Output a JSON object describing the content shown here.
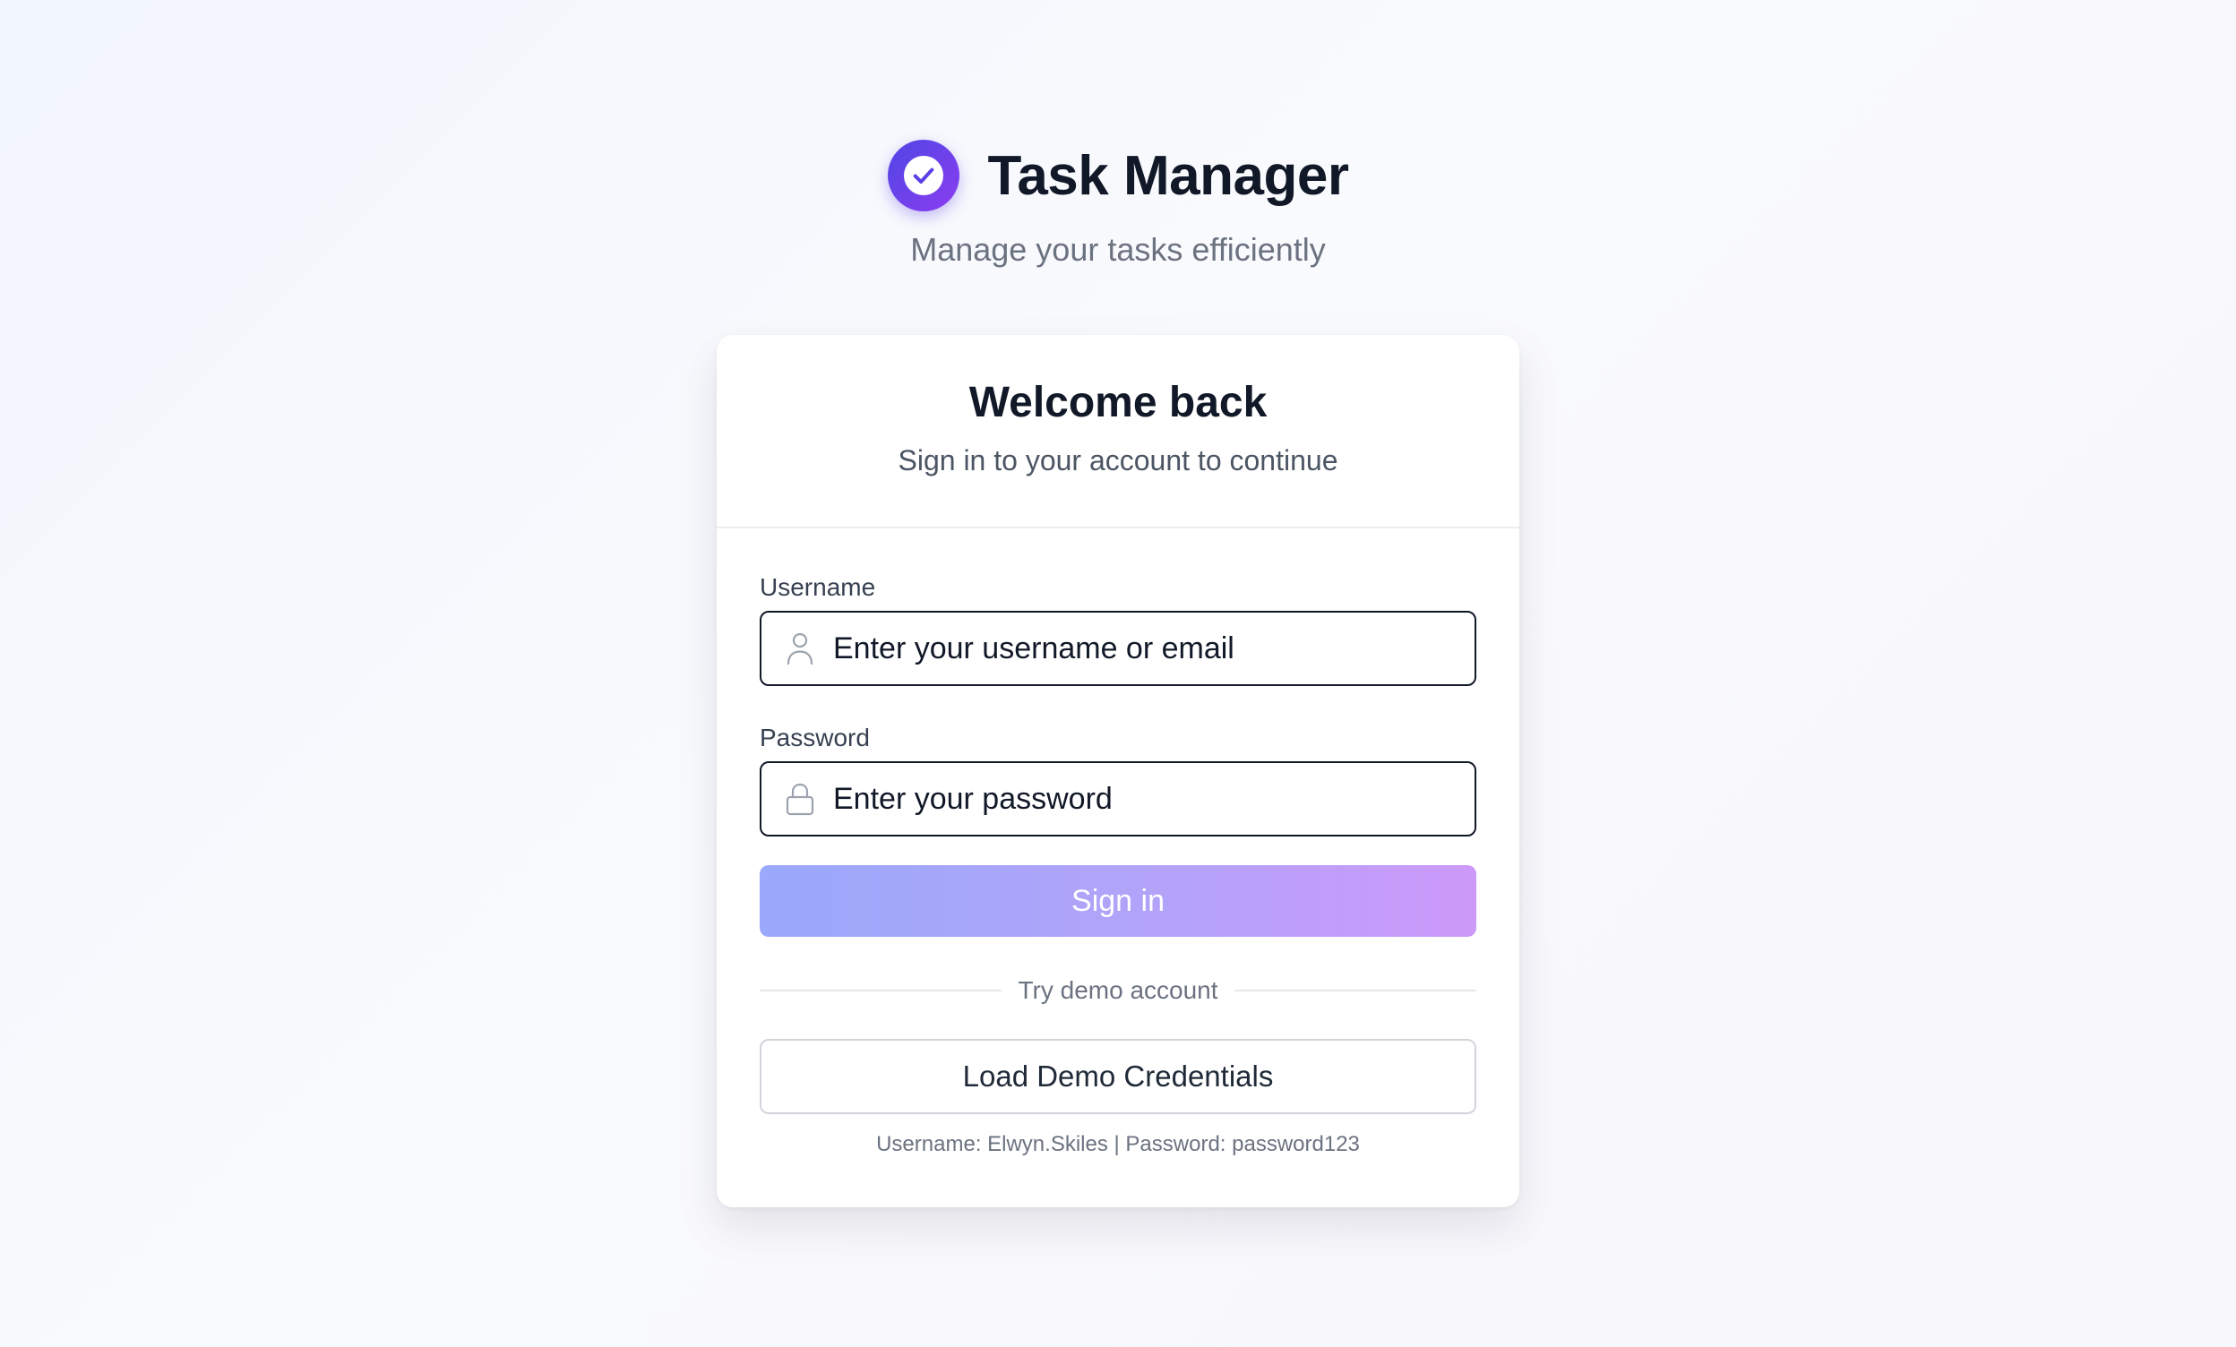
{
  "brand": {
    "title": "Task Manager",
    "subtitle": "Manage your tasks efficiently",
    "logo_icon": "check-circle-icon",
    "accent_from": "#4f46e5",
    "accent_to": "#8b3df0"
  },
  "card": {
    "title": "Welcome back",
    "subtitle": "Sign in to your account to continue"
  },
  "form": {
    "username": {
      "label": "Username",
      "placeholder": "Enter your username or email",
      "value": "",
      "icon": "user-icon"
    },
    "password": {
      "label": "Password",
      "placeholder": "Enter your password",
      "value": "",
      "icon": "lock-icon"
    },
    "submit_label": "Sign in"
  },
  "demo": {
    "divider_text": "Try demo account",
    "button_label": "Load Demo Credentials",
    "hint": "Username: Elwyn.Skiles | Password: password123"
  }
}
